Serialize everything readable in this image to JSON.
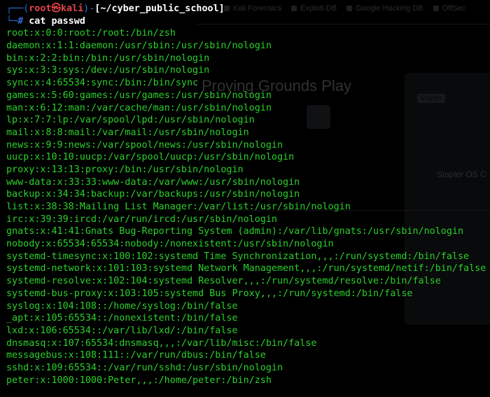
{
  "background_window": {
    "tabs": [
      "Kali Forensics",
      "Exploit-DB",
      "Google Hacking DB",
      "OffSec"
    ],
    "heading": "Proving Grounds Play",
    "card_badge": "Stapler",
    "card_title": "Stapler OS C"
  },
  "terminal": {
    "prompt": {
      "corner_top": "┌──",
      "open_paren": "(",
      "user": "root",
      "at_symbol": "㉿",
      "host": "kali",
      "close_paren": ")",
      "dash": "-",
      "directory": "[~/cyber_public_school]",
      "corner_bottom": "└─",
      "hash": "#"
    },
    "command": "cat passwd",
    "output": [
      "root:x:0:0:root:/root:/bin/zsh",
      "daemon:x:1:1:daemon:/usr/sbin:/usr/sbin/nologin",
      "bin:x:2:2:bin:/bin:/usr/sbin/nologin",
      "sys:x:3:3:sys:/dev:/usr/sbin/nologin",
      "sync:x:4:65534:sync:/bin:/bin/sync",
      "games:x:5:60:games:/usr/games:/usr/sbin/nologin",
      "man:x:6:12:man:/var/cache/man:/usr/sbin/nologin",
      "lp:x:7:7:lp:/var/spool/lpd:/usr/sbin/nologin",
      "mail:x:8:8:mail:/var/mail:/usr/sbin/nologin",
      "news:x:9:9:news:/var/spool/news:/usr/sbin/nologin",
      "uucp:x:10:10:uucp:/var/spool/uucp:/usr/sbin/nologin",
      "proxy:x:13:13:proxy:/bin:/usr/sbin/nologin",
      "www-data:x:33:33:www-data:/var/www:/usr/sbin/nologin",
      "backup:x:34:34:backup:/var/backups:/usr/sbin/nologin",
      "list:x:38:38:Mailing List Manager:/var/list:/usr/sbin/nologin",
      "irc:x:39:39:ircd:/var/run/ircd:/usr/sbin/nologin",
      "gnats:x:41:41:Gnats Bug-Reporting System (admin):/var/lib/gnats:/usr/sbin/nologin",
      "nobody:x:65534:65534:nobody:/nonexistent:/usr/sbin/nologin",
      "systemd-timesync:x:100:102:systemd Time Synchronization,,,:/run/systemd:/bin/false",
      "systemd-network:x:101:103:systemd Network Management,,,:/run/systemd/netif:/bin/false",
      "systemd-resolve:x:102:104:systemd Resolver,,,:/run/systemd/resolve:/bin/false",
      "systemd-bus-proxy:x:103:105:systemd Bus Proxy,,,:/run/systemd:/bin/false",
      "syslog:x:104:108::/home/syslog:/bin/false",
      "_apt:x:105:65534::/nonexistent:/bin/false",
      "lxd:x:106:65534::/var/lib/lxd/:/bin/false",
      "dnsmasq:x:107:65534:dnsmasq,,,:/var/lib/misc:/bin/false",
      "messagebus:x:108:111::/var/run/dbus:/bin/false",
      "sshd:x:109:65534::/var/run/sshd:/usr/sbin/nologin",
      "peter:x:1000:1000:Peter,,,:/home/peter:/bin/zsh"
    ]
  },
  "colors": {
    "background": "#000000",
    "prompt_accent": "#2f6bd8",
    "prompt_user": "#e0454a",
    "output_text": "#2bd12b",
    "command_text": "#ffffff"
  }
}
